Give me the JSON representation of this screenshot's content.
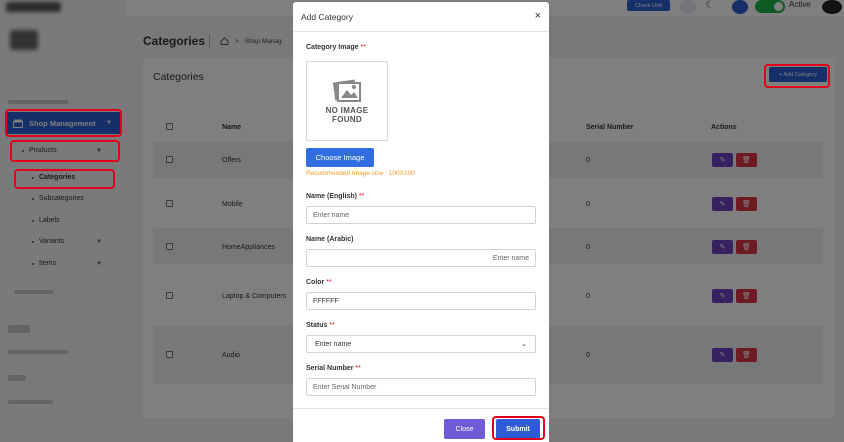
{
  "sidebar": {
    "shop_management": "Shop Management",
    "products": "Products",
    "categories": "Categories",
    "subcategories": "Subcategories",
    "labels": "Labels",
    "variants": "Variants",
    "items": "Items"
  },
  "topbar": {
    "check_unit": "Check Unit",
    "status": "Active"
  },
  "page": {
    "title": "Categories",
    "breadcrumb": "Shop Manag"
  },
  "card": {
    "title": "Categories",
    "add_button": "+ Add Category"
  },
  "table": {
    "headers": {
      "name": "Name",
      "serial": "Serial Number",
      "actions": "Actions"
    },
    "rows": [
      {
        "name": "Offers",
        "serial": "0"
      },
      {
        "name": "Mobile",
        "serial": "0"
      },
      {
        "name": "HomeAppliances",
        "serial": "0"
      },
      {
        "name": "Laptop & Computers",
        "serial": "0"
      },
      {
        "name": "Audio",
        "serial": "0"
      }
    ]
  },
  "modal": {
    "title": "Add Category",
    "close_symbol": "×",
    "category_image_label": "Category Image",
    "required_mark": "**",
    "no_image_line1": "NO IMAGE",
    "no_image_line2": "FOUND",
    "choose_image": "Choose Image",
    "image_hint": "Recommended Image size : 100X100",
    "name_en_label": "Name (English)",
    "name_en_placeholder": "Enter name",
    "name_ar_label": "Name (Arabic)",
    "name_ar_placeholder": "Enter name",
    "color_label": "Color",
    "color_value": "FFFFFF",
    "status_label": "Status",
    "status_value": "Enter name",
    "serial_label": "Serial Number",
    "serial_placeholder": "Enter Serial Number",
    "close_button": "Close",
    "submit_button": "Submit"
  },
  "colors": {
    "primary": "#2a5fd2",
    "close_button": "#6f5bd6",
    "highlight": "#e0001b",
    "hint": "#f29a1f",
    "edit": "#6f42c1",
    "delete": "#dc3545"
  }
}
